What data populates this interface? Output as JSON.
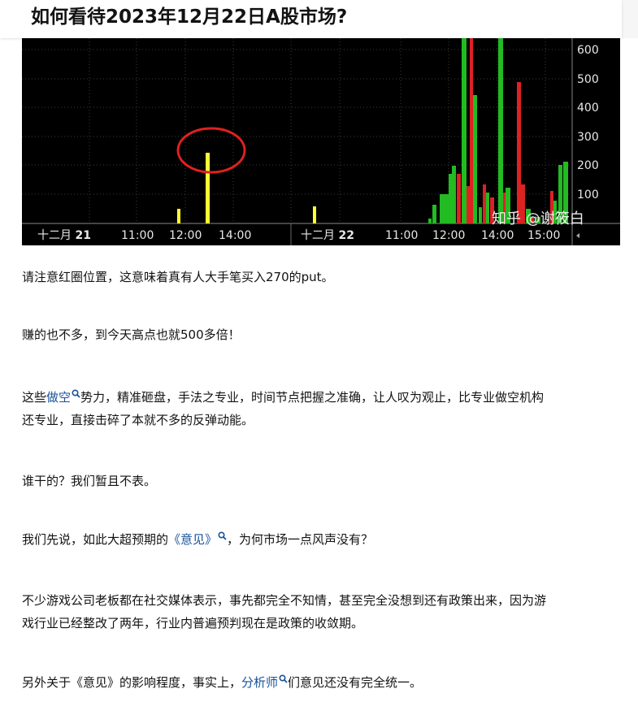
{
  "article": {
    "title": "如何看待2023年12月22日A股市场?"
  },
  "chart": {
    "watermark": "知乎 @谢筱白",
    "y_ticks": [
      "600",
      "500",
      "400",
      "300",
      "200",
      "100"
    ],
    "x_labels": [
      {
        "text": "十二月 ",
        "bold": "21"
      },
      {
        "text": "11:00"
      },
      {
        "text": "12:00"
      },
      {
        "text": "14:00"
      },
      {
        "text": "十二月 ",
        "bold": "22"
      },
      {
        "text": "11:00"
      },
      {
        "text": "12:00"
      },
      {
        "text": "14:00"
      },
      {
        "text": "15:00"
      }
    ],
    "colors": {
      "yellow": "#ffff33",
      "green": "#22bb22",
      "red": "#dd2222",
      "highlight": "#e02020"
    }
  },
  "paragraphs": {
    "p1": "请注意红圈位置，这意味着真有人大手笔买入270的put。",
    "p2": "赚的也不多，到今天高点也就500多倍！",
    "p3_pre": "这些",
    "p3_link": "做空",
    "p3_post_line1": "势力，精准砸盘，手法之专业，时间节点把握之准确，让人叹为观止，比专业做空机构",
    "p3_line2": "还专业，直接击碎了本就不多的反弹动能。",
    "p4": "谁干的？我们暂且不表。",
    "p5_pre": "我们先说，如此大超预期的",
    "p5_link": "《意见》",
    "p5_post": "，为何市场一点风声没有？",
    "p6_line1": "不少游戏公司老板都在社交媒体表示，事先都完全不知情，甚至完全没想到还有政策出来，因为游",
    "p6_line2": "戏行业已经整改了两年，行业内普遍预判现在是政策的收敛期。",
    "p7_pre": "另外关于《意见》的影响程度，事实上，",
    "p7_link": "分析师",
    "p7_post": "们意见还没有完全统一。"
  }
}
